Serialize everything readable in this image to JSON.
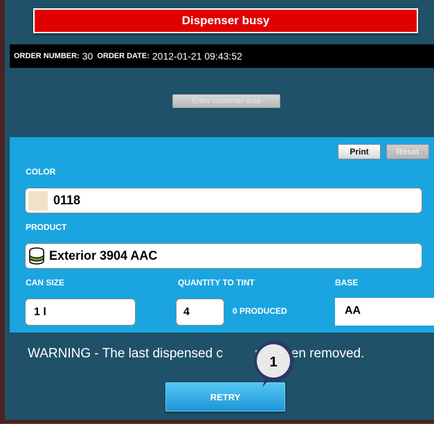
{
  "alert": {
    "text": "Dispenser busy",
    "color": "#e00000"
  },
  "order": {
    "number_label": "ORDER NUMBER:",
    "number_value": "30",
    "date_label": "ORDER DATE:",
    "date_value": "2012-01-21 09:43:52"
  },
  "customer": {
    "button_label": "Enter customer data"
  },
  "toolbar": {
    "print_label": "Print",
    "reset_label": "Reset"
  },
  "color": {
    "label": "COLOR",
    "value": "0118",
    "swatch": "#efe2c8"
  },
  "product": {
    "label": "PRODUCT",
    "value": "Exterior 3904 AAC",
    "icon": "paint-can-icon"
  },
  "can_size": {
    "label": "CAN SIZE",
    "value": "1 l"
  },
  "quantity": {
    "label": "QUANTITY TO TINT",
    "value": "4",
    "produced": "0 PRODUCED"
  },
  "base": {
    "label": "BASE",
    "value": "AA"
  },
  "warning": {
    "text": "WARNING - The last dispensed c",
    "text_tail": "not been removed."
  },
  "retry": {
    "label": "RETRY"
  },
  "callout": {
    "number": "1"
  },
  "colors": {
    "accent": "#1aa5e0",
    "dark_panel": "#1f5168",
    "frame": "#4a2424"
  }
}
